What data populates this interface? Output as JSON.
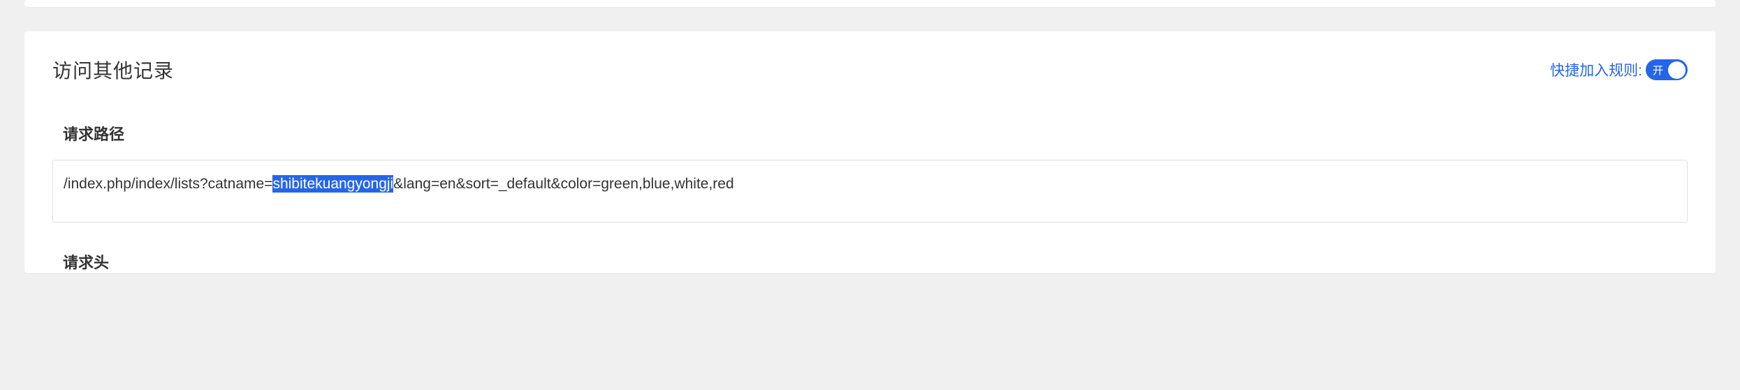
{
  "card": {
    "title": "访问其他记录"
  },
  "toggle": {
    "label": "快捷加入规则:",
    "state_text": "开"
  },
  "request_path": {
    "label": "请求路径",
    "value_prefix": "/index.php/index/lists?catname=",
    "value_highlighted": "shibitekuangyongji",
    "value_suffix": "&lang=en&sort=_default&color=green,blue,white,red"
  },
  "request_header": {
    "label": "请求头"
  }
}
